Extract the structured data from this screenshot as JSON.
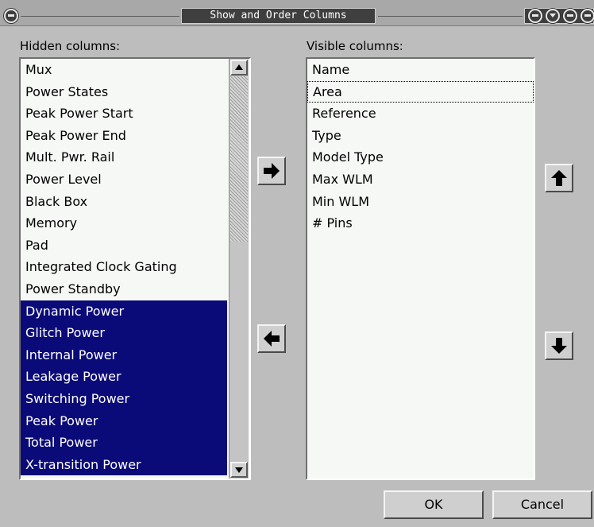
{
  "window": {
    "title": "Show and Order Columns"
  },
  "hidden_panel": {
    "label": "Hidden columns:",
    "items": [
      {
        "label": "Mux",
        "selected": false
      },
      {
        "label": "Power States",
        "selected": false
      },
      {
        "label": "Peak Power Start",
        "selected": false
      },
      {
        "label": "Peak Power End",
        "selected": false
      },
      {
        "label": "Mult. Pwr. Rail",
        "selected": false
      },
      {
        "label": "Power Level",
        "selected": false
      },
      {
        "label": "Black Box",
        "selected": false
      },
      {
        "label": "Memory",
        "selected": false
      },
      {
        "label": "Pad",
        "selected": false
      },
      {
        "label": "Integrated Clock Gating",
        "selected": false
      },
      {
        "label": "Power Standby",
        "selected": false
      },
      {
        "label": "Dynamic Power",
        "selected": true
      },
      {
        "label": "Glitch Power",
        "selected": true
      },
      {
        "label": "Internal Power",
        "selected": true
      },
      {
        "label": "Leakage Power",
        "selected": true
      },
      {
        "label": "Switching Power",
        "selected": true
      },
      {
        "label": "Peak Power",
        "selected": true
      },
      {
        "label": "Total Power",
        "selected": true
      },
      {
        "label": "X-transition Power",
        "selected": true
      }
    ]
  },
  "visible_panel": {
    "label": "Visible columns:",
    "items": [
      {
        "label": "Name",
        "focused": false
      },
      {
        "label": "Area",
        "focused": true
      },
      {
        "label": "Reference",
        "focused": false
      },
      {
        "label": "Type",
        "focused": false
      },
      {
        "label": "Model Type",
        "focused": false
      },
      {
        "label": "Max WLM",
        "focused": false
      },
      {
        "label": "Min WLM",
        "focused": false
      },
      {
        "label": "# Pins",
        "focused": false
      }
    ]
  },
  "buttons": {
    "ok": "OK",
    "cancel": "Cancel"
  },
  "icons": {
    "move_right": "arrow-right-icon",
    "move_left": "arrow-left-icon",
    "move_up": "arrow-up-icon",
    "move_down": "arrow-down-icon"
  },
  "colors": {
    "selection_bg": "#0a0a78",
    "selection_fg": "#ffffff",
    "dialog_bg": "#bdbdbd",
    "list_bg": "#f6f8f6"
  }
}
